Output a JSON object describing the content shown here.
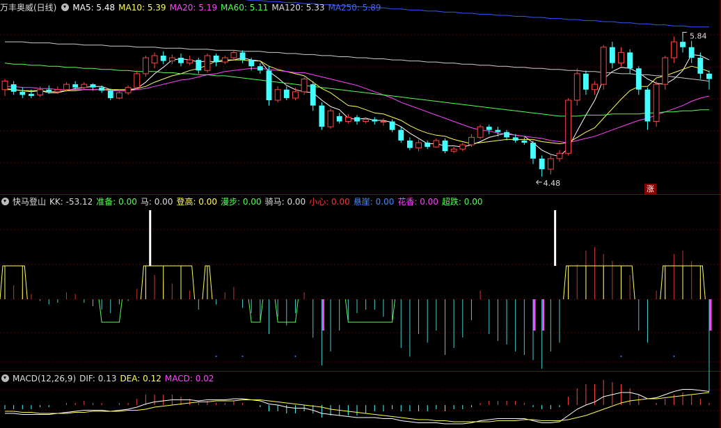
{
  "main_panel": {
    "title": "万丰奥威(日线)",
    "indicators": [
      {
        "label": "MA5: 5.48",
        "color": "#ffffff"
      },
      {
        "label": "MA10: 5.39",
        "color": "#ffff55"
      },
      {
        "label": "MA20: 5.19",
        "color": "#ff44ff"
      },
      {
        "label": "MA60: 5.11",
        "color": "#55ff55"
      },
      {
        "label": "MA120: 5.33",
        "color": "#dddddd"
      },
      {
        "label": "MA250: 5.89",
        "color": "#4466ff"
      }
    ],
    "high_label": "5.84",
    "low_label": "4.48",
    "flag_label": "涨"
  },
  "signal_panel": {
    "title": "快马登山",
    "indicators": [
      {
        "label": "KK: -53.12",
        "color": "#dddddd"
      },
      {
        "label": "准备: 0.00",
        "color": "#55ff55"
      },
      {
        "label": "马: 0.00",
        "color": "#dddddd"
      },
      {
        "label": "登高: 0.00",
        "color": "#ffff55"
      },
      {
        "label": "漫步: 0.00",
        "color": "#55ff55"
      },
      {
        "label": "骑马: 0.00",
        "color": "#dddddd"
      },
      {
        "label": "小心: 0.00",
        "color": "#ff3333"
      },
      {
        "label": "悬崖: 0.00",
        "color": "#4488ff"
      },
      {
        "label": "花香: 0.00",
        "color": "#ff44ff"
      },
      {
        "label": "超跌: 0.00",
        "color": "#55ff55"
      }
    ]
  },
  "macd_panel": {
    "title": "MACD(12,26,9)",
    "indicators": [
      {
        "label": "DIF: 0.13",
        "color": "#dddddd"
      },
      {
        "label": "DEA: 0.12",
        "color": "#ffff55"
      },
      {
        "label": "MACD: 0.02",
        "color": "#ff44ff"
      }
    ]
  },
  "chart_data": {
    "type": "candlestick",
    "title": "万丰奥威(日线)",
    "xlabel": "",
    "ylabel": "",
    "ylim": [
      4.4,
      6.0
    ],
    "grid": true,
    "candles": [
      [
        5.3,
        5.38,
        5.4,
        5.24
      ],
      [
        5.35,
        5.28,
        5.38,
        5.25
      ],
      [
        5.28,
        5.25,
        5.32,
        5.22
      ],
      [
        5.26,
        5.24,
        5.3,
        5.22
      ],
      [
        5.25,
        5.3,
        5.33,
        5.23
      ],
      [
        5.3,
        5.28,
        5.34,
        5.26
      ],
      [
        5.28,
        5.3,
        5.33,
        5.26
      ],
      [
        5.3,
        5.35,
        5.37,
        5.28
      ],
      [
        5.35,
        5.32,
        5.38,
        5.3
      ],
      [
        5.32,
        5.35,
        5.37,
        5.3
      ],
      [
        5.35,
        5.32,
        5.36,
        5.29
      ],
      [
        5.32,
        5.29,
        5.34,
        5.27
      ],
      [
        5.29,
        5.22,
        5.31,
        5.2
      ],
      [
        5.22,
        5.27,
        5.3,
        5.21
      ],
      [
        5.27,
        5.32,
        5.34,
        5.25
      ],
      [
        5.32,
        5.45,
        5.48,
        5.3
      ],
      [
        5.45,
        5.6,
        5.62,
        5.42
      ],
      [
        5.55,
        5.62,
        5.65,
        5.5
      ],
      [
        5.62,
        5.57,
        5.66,
        5.54
      ],
      [
        5.57,
        5.6,
        5.63,
        5.54
      ],
      [
        5.6,
        5.55,
        5.64,
        5.52
      ],
      [
        5.55,
        5.58,
        5.62,
        5.53
      ],
      [
        5.58,
        5.48,
        5.6,
        5.45
      ],
      [
        5.48,
        5.62,
        5.64,
        5.46
      ],
      [
        5.62,
        5.56,
        5.64,
        5.52
      ],
      [
        5.56,
        5.6,
        5.62,
        5.54
      ],
      [
        5.6,
        5.65,
        5.67,
        5.58
      ],
      [
        5.65,
        5.58,
        5.67,
        5.55
      ],
      [
        5.58,
        5.52,
        5.6,
        5.48
      ],
      [
        5.52,
        5.48,
        5.55,
        5.45
      ],
      [
        5.48,
        5.2,
        5.52,
        5.15
      ],
      [
        5.2,
        5.3,
        5.33,
        5.18
      ],
      [
        5.3,
        5.22,
        5.33,
        5.2
      ],
      [
        5.22,
        5.28,
        5.32,
        5.2
      ],
      [
        5.28,
        5.4,
        5.42,
        5.25
      ],
      [
        5.35,
        5.15,
        5.38,
        5.1
      ],
      [
        5.15,
        4.95,
        5.18,
        4.92
      ],
      [
        4.95,
        5.1,
        5.12,
        4.93
      ],
      [
        5.05,
        5.0,
        5.08,
        4.98
      ],
      [
        5.0,
        5.04,
        5.07,
        4.98
      ],
      [
        5.04,
        5.0,
        5.06,
        4.97
      ],
      [
        5.0,
        5.02,
        5.04,
        4.98
      ],
      [
        5.02,
        5.0,
        5.04,
        4.97
      ],
      [
        5.0,
        5.0,
        5.03,
        4.96
      ],
      [
        5.0,
        4.92,
        5.02,
        4.9
      ],
      [
        4.92,
        4.82,
        4.95,
        4.8
      ],
      [
        4.82,
        4.75,
        4.85,
        4.73
      ],
      [
        4.75,
        4.8,
        4.83,
        4.72
      ],
      [
        4.8,
        4.76,
        4.82,
        4.74
      ],
      [
        4.76,
        4.82,
        4.84,
        4.75
      ],
      [
        4.82,
        4.72,
        4.84,
        4.7
      ],
      [
        4.72,
        4.74,
        4.76,
        4.7
      ],
      [
        4.74,
        4.78,
        4.8,
        4.72
      ],
      [
        4.78,
        4.85,
        4.88,
        4.76
      ],
      [
        4.85,
        4.95,
        4.97,
        4.83
      ],
      [
        4.95,
        4.92,
        4.97,
        4.88
      ],
      [
        4.92,
        4.9,
        4.95,
        4.86
      ],
      [
        4.9,
        4.85,
        4.92,
        4.82
      ],
      [
        4.85,
        4.82,
        4.88,
        4.8
      ],
      [
        4.82,
        4.8,
        4.85,
        4.78
      ],
      [
        4.8,
        4.65,
        4.82,
        4.6
      ],
      [
        4.65,
        4.55,
        4.68,
        4.48
      ],
      [
        4.55,
        4.65,
        4.68,
        4.5
      ],
      [
        4.65,
        4.7,
        4.73,
        4.62
      ],
      [
        4.7,
        5.2,
        5.22,
        4.68
      ],
      [
        5.2,
        5.45,
        5.5,
        5.15
      ],
      [
        5.45,
        5.3,
        5.48,
        5.25
      ],
      [
        5.3,
        5.35,
        5.38,
        5.25
      ],
      [
        5.35,
        5.7,
        5.72,
        5.3
      ],
      [
        5.7,
        5.55,
        5.75,
        5.5
      ],
      [
        5.55,
        5.65,
        5.7,
        5.52
      ],
      [
        5.65,
        5.5,
        5.68,
        5.45
      ],
      [
        5.5,
        5.3,
        5.52,
        5.25
      ],
      [
        5.3,
        5.0,
        5.32,
        4.92
      ],
      [
        5.0,
        5.35,
        5.38,
        4.95
      ],
      [
        5.35,
        5.6,
        5.62,
        5.3
      ],
      [
        5.6,
        5.75,
        5.8,
        5.55
      ],
      [
        5.75,
        5.7,
        5.84,
        5.65
      ],
      [
        5.7,
        5.6,
        5.76,
        5.55
      ],
      [
        5.6,
        5.45,
        5.65,
        5.4
      ],
      [
        5.45,
        5.4,
        5.48,
        5.3
      ]
    ],
    "series": [
      {
        "name": "MA5",
        "values": [
          5.31,
          5.3,
          5.29,
          5.28,
          5.29,
          5.27,
          5.27,
          5.29,
          5.31,
          5.32,
          5.33,
          5.33,
          5.3,
          5.29,
          5.29,
          5.31,
          5.37,
          5.45,
          5.51,
          5.58,
          5.59,
          5.58,
          5.56,
          5.57,
          5.56,
          5.57,
          5.58,
          5.6,
          5.58,
          5.57,
          5.47,
          5.41,
          5.34,
          5.3,
          5.28,
          5.27,
          5.2,
          5.14,
          5.11,
          5.03,
          5.02,
          5.03,
          5.01,
          5.01,
          4.99,
          4.95,
          4.89,
          4.84,
          4.79,
          4.79,
          4.77,
          4.77,
          4.76,
          4.78,
          4.81,
          4.85,
          4.87,
          4.89,
          4.87,
          4.86,
          4.8,
          4.73,
          4.69,
          4.67,
          4.75,
          4.91,
          5.06,
          5.2,
          5.4,
          5.47,
          5.51,
          5.5,
          5.46,
          5.4,
          5.36,
          5.35,
          5.4,
          5.48,
          5.63,
          5.62,
          5.58
        ]
      },
      {
        "name": "MA10",
        "values": [
          5.3,
          5.3,
          5.29,
          5.29,
          5.29,
          5.28,
          5.28,
          5.29,
          5.29,
          5.3,
          5.3,
          5.3,
          5.3,
          5.3,
          5.3,
          5.31,
          5.33,
          5.37,
          5.4,
          5.43,
          5.45,
          5.48,
          5.5,
          5.53,
          5.57,
          5.58,
          5.58,
          5.58,
          5.57,
          5.57,
          5.52,
          5.49,
          5.47,
          5.45,
          5.43,
          5.37,
          5.31,
          5.27,
          5.21,
          5.15,
          5.14,
          5.11,
          5.08,
          5.07,
          5.04,
          5.01,
          4.96,
          4.92,
          4.89,
          4.87,
          4.86,
          4.83,
          4.81,
          4.79,
          4.8,
          4.81,
          4.82,
          4.83,
          4.83,
          4.83,
          4.83,
          4.81,
          4.8,
          4.79,
          4.8,
          4.85,
          4.9,
          4.94,
          5.03,
          5.12,
          5.21,
          5.29,
          5.33,
          5.33,
          5.41,
          5.43,
          5.46,
          5.49,
          5.52,
          5.5,
          5.47
        ]
      },
      {
        "name": "MA20",
        "values": [
          5.33,
          5.33,
          5.32,
          5.32,
          5.31,
          5.31,
          5.3,
          5.3,
          5.3,
          5.3,
          5.3,
          5.3,
          5.29,
          5.29,
          5.29,
          5.3,
          5.31,
          5.33,
          5.35,
          5.37,
          5.39,
          5.4,
          5.42,
          5.44,
          5.45,
          5.47,
          5.48,
          5.49,
          5.5,
          5.5,
          5.49,
          5.48,
          5.47,
          5.46,
          5.46,
          5.44,
          5.42,
          5.4,
          5.38,
          5.36,
          5.34,
          5.31,
          5.28,
          5.25,
          5.22,
          5.18,
          5.15,
          5.12,
          5.09,
          5.06,
          5.03,
          5.0,
          4.97,
          4.94,
          4.92,
          4.91,
          4.89,
          4.88,
          4.87,
          4.86,
          4.85,
          4.84,
          4.82,
          4.81,
          4.8,
          4.82,
          4.84,
          4.86,
          4.89,
          4.92,
          4.95,
          4.98,
          5.01,
          5.03,
          5.06,
          5.09,
          5.12,
          5.15,
          5.19,
          5.22,
          5.24
        ]
      },
      {
        "name": "MA60",
        "values": [
          5.55,
          5.54,
          5.54,
          5.53,
          5.53,
          5.52,
          5.52,
          5.51,
          5.51,
          5.5,
          5.5,
          5.49,
          5.49,
          5.48,
          5.48,
          5.47,
          5.47,
          5.47,
          5.46,
          5.46,
          5.45,
          5.45,
          5.44,
          5.44,
          5.43,
          5.43,
          5.42,
          5.41,
          5.4,
          5.39,
          5.38,
          5.37,
          5.36,
          5.35,
          5.34,
          5.33,
          5.32,
          5.31,
          5.3,
          5.29,
          5.28,
          5.27,
          5.26,
          5.25,
          5.24,
          5.23,
          5.22,
          5.21,
          5.2,
          5.19,
          5.18,
          5.17,
          5.16,
          5.15,
          5.14,
          5.13,
          5.12,
          5.11,
          5.1,
          5.09,
          5.08,
          5.07,
          5.06,
          5.05,
          5.05,
          5.05,
          5.06,
          5.06,
          5.06,
          5.07,
          5.07,
          5.07,
          5.07,
          5.08,
          5.08,
          5.09,
          5.09,
          5.1,
          5.1,
          5.11,
          5.11
        ]
      },
      {
        "name": "MA120",
        "values": [
          5.75,
          5.75,
          5.75,
          5.74,
          5.74,
          5.74,
          5.73,
          5.73,
          5.73,
          5.72,
          5.72,
          5.72,
          5.71,
          5.71,
          5.71,
          5.7,
          5.7,
          5.7,
          5.69,
          5.69,
          5.69,
          5.68,
          5.68,
          5.68,
          5.67,
          5.67,
          5.67,
          5.66,
          5.66,
          5.66,
          5.65,
          5.65,
          5.64,
          5.64,
          5.63,
          5.63,
          5.62,
          5.62,
          5.61,
          5.61,
          5.6,
          5.6,
          5.59,
          5.59,
          5.58,
          5.58,
          5.57,
          5.57,
          5.56,
          5.56,
          5.55,
          5.55,
          5.54,
          5.54,
          5.53,
          5.53,
          5.52,
          5.52,
          5.51,
          5.51,
          5.5,
          5.5,
          5.49,
          5.49,
          5.48,
          5.48,
          5.47,
          5.47,
          5.46,
          5.46,
          5.45,
          5.45,
          5.44,
          5.44,
          5.43,
          5.43,
          5.42,
          5.41,
          5.4,
          5.39,
          5.38
        ]
      },
      {
        "name": "MA250",
        "values": [
          6.28,
          6.28,
          6.27,
          6.27,
          6.26,
          6.26,
          6.25,
          6.25,
          6.24,
          6.24,
          6.23,
          6.23,
          6.22,
          6.22,
          6.21,
          6.21,
          6.2,
          6.2,
          6.19,
          6.19,
          6.18,
          6.18,
          6.17,
          6.17,
          6.16,
          6.16,
          6.15,
          6.15,
          6.14,
          6.14,
          6.13,
          6.13,
          6.12,
          6.12,
          6.11,
          6.11,
          6.1,
          6.1,
          6.09,
          6.09,
          6.08,
          6.08,
          6.07,
          6.07,
          6.06,
          6.06,
          6.05,
          6.05,
          6.04,
          6.04,
          6.03,
          6.03,
          6.02,
          6.02,
          6.01,
          6.01,
          6.0,
          6.0,
          5.99,
          5.99,
          5.98,
          5.98,
          5.97,
          5.97,
          5.96,
          5.96,
          5.95,
          5.95,
          5.94,
          5.94,
          5.93,
          5.93,
          5.92,
          5.92,
          5.91,
          5.91,
          5.9,
          5.9,
          5.89,
          5.89,
          5.89
        ]
      }
    ],
    "signal": {
      "kk": [
        10,
        8,
        6,
        3,
        -1,
        -3,
        -2,
        4,
        3,
        -2,
        -4,
        -6,
        -8,
        -3,
        -1,
        6,
        12,
        14,
        11,
        9,
        6,
        5,
        -6,
        9,
        -3,
        4,
        7,
        -5,
        -8,
        -12,
        -20,
        -10,
        -15,
        -8,
        4,
        -22,
        -38,
        -30,
        -18,
        -12,
        -8,
        -6,
        -6,
        -10,
        -12,
        -28,
        -33,
        -20,
        -25,
        -18,
        -32,
        -28,
        -22,
        -12,
        5,
        -20,
        -24,
        -26,
        -30,
        -32,
        -35,
        -40,
        -30,
        -25,
        10,
        20,
        28,
        30,
        26,
        22,
        18,
        14,
        -18,
        -25,
        5,
        18,
        26,
        28,
        22,
        12,
        -53
      ]
    },
    "macd": {
      "dif": [
        -0.08,
        -0.08,
        -0.09,
        -0.09,
        -0.09,
        -0.09,
        -0.08,
        -0.07,
        -0.06,
        -0.05,
        -0.05,
        -0.05,
        -0.06,
        -0.05,
        -0.04,
        -0.02,
        0.01,
        0.03,
        0.04,
        0.05,
        0.05,
        0.05,
        0.04,
        0.05,
        0.05,
        0.05,
        0.06,
        0.06,
        0.05,
        0.04,
        0.01,
        0.0,
        -0.02,
        -0.03,
        -0.03,
        -0.05,
        -0.08,
        -0.09,
        -0.1,
        -0.11,
        -0.12,
        -0.12,
        -0.12,
        -0.13,
        -0.13,
        -0.15,
        -0.16,
        -0.17,
        -0.17,
        -0.17,
        -0.18,
        -0.18,
        -0.18,
        -0.17,
        -0.15,
        -0.14,
        -0.13,
        -0.13,
        -0.13,
        -0.13,
        -0.15,
        -0.17,
        -0.17,
        -0.16,
        -0.1,
        -0.04,
        0.0,
        0.03,
        0.08,
        0.1,
        0.12,
        0.12,
        0.1,
        0.06,
        0.07,
        0.1,
        0.13,
        0.15,
        0.15,
        0.14,
        0.13
      ],
      "dea": [
        -0.06,
        -0.06,
        -0.07,
        -0.07,
        -0.08,
        -0.08,
        -0.08,
        -0.08,
        -0.07,
        -0.07,
        -0.06,
        -0.06,
        -0.06,
        -0.06,
        -0.05,
        -0.05,
        -0.04,
        -0.02,
        -0.01,
        0.0,
        0.01,
        0.02,
        0.03,
        0.03,
        0.04,
        0.04,
        0.04,
        0.05,
        0.05,
        0.05,
        0.04,
        0.03,
        0.02,
        0.01,
        0.0,
        -0.01,
        -0.02,
        -0.04,
        -0.05,
        -0.06,
        -0.07,
        -0.08,
        -0.09,
        -0.1,
        -0.11,
        -0.12,
        -0.13,
        -0.14,
        -0.14,
        -0.15,
        -0.15,
        -0.16,
        -0.16,
        -0.16,
        -0.16,
        -0.16,
        -0.15,
        -0.15,
        -0.15,
        -0.14,
        -0.14,
        -0.15,
        -0.15,
        -0.15,
        -0.14,
        -0.12,
        -0.1,
        -0.07,
        -0.04,
        -0.01,
        0.02,
        0.04,
        0.05,
        0.06,
        0.06,
        0.07,
        0.08,
        0.09,
        0.1,
        0.11,
        0.12
      ],
      "ylim": [
        -0.22,
        0.2
      ]
    }
  }
}
